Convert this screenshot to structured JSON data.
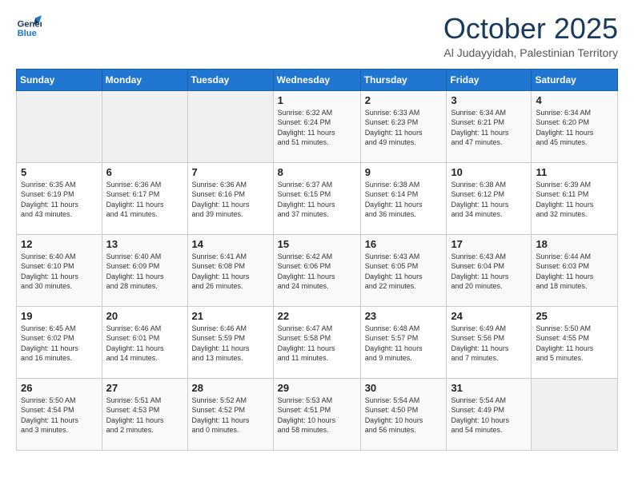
{
  "logo": {
    "line1": "General",
    "line2": "Blue"
  },
  "title": "October 2025",
  "location": "Al Judayyidah, Palestinian Territory",
  "headers": [
    "Sunday",
    "Monday",
    "Tuesday",
    "Wednesday",
    "Thursday",
    "Friday",
    "Saturday"
  ],
  "weeks": [
    [
      {
        "day": "",
        "info": ""
      },
      {
        "day": "",
        "info": ""
      },
      {
        "day": "",
        "info": ""
      },
      {
        "day": "1",
        "info": "Sunrise: 6:32 AM\nSunset: 6:24 PM\nDaylight: 11 hours\nand 51 minutes."
      },
      {
        "day": "2",
        "info": "Sunrise: 6:33 AM\nSunset: 6:23 PM\nDaylight: 11 hours\nand 49 minutes."
      },
      {
        "day": "3",
        "info": "Sunrise: 6:34 AM\nSunset: 6:21 PM\nDaylight: 11 hours\nand 47 minutes."
      },
      {
        "day": "4",
        "info": "Sunrise: 6:34 AM\nSunset: 6:20 PM\nDaylight: 11 hours\nand 45 minutes."
      }
    ],
    [
      {
        "day": "5",
        "info": "Sunrise: 6:35 AM\nSunset: 6:19 PM\nDaylight: 11 hours\nand 43 minutes."
      },
      {
        "day": "6",
        "info": "Sunrise: 6:36 AM\nSunset: 6:17 PM\nDaylight: 11 hours\nand 41 minutes."
      },
      {
        "day": "7",
        "info": "Sunrise: 6:36 AM\nSunset: 6:16 PM\nDaylight: 11 hours\nand 39 minutes."
      },
      {
        "day": "8",
        "info": "Sunrise: 6:37 AM\nSunset: 6:15 PM\nDaylight: 11 hours\nand 37 minutes."
      },
      {
        "day": "9",
        "info": "Sunrise: 6:38 AM\nSunset: 6:14 PM\nDaylight: 11 hours\nand 36 minutes."
      },
      {
        "day": "10",
        "info": "Sunrise: 6:38 AM\nSunset: 6:12 PM\nDaylight: 11 hours\nand 34 minutes."
      },
      {
        "day": "11",
        "info": "Sunrise: 6:39 AM\nSunset: 6:11 PM\nDaylight: 11 hours\nand 32 minutes."
      }
    ],
    [
      {
        "day": "12",
        "info": "Sunrise: 6:40 AM\nSunset: 6:10 PM\nDaylight: 11 hours\nand 30 minutes."
      },
      {
        "day": "13",
        "info": "Sunrise: 6:40 AM\nSunset: 6:09 PM\nDaylight: 11 hours\nand 28 minutes."
      },
      {
        "day": "14",
        "info": "Sunrise: 6:41 AM\nSunset: 6:08 PM\nDaylight: 11 hours\nand 26 minutes."
      },
      {
        "day": "15",
        "info": "Sunrise: 6:42 AM\nSunset: 6:06 PM\nDaylight: 11 hours\nand 24 minutes."
      },
      {
        "day": "16",
        "info": "Sunrise: 6:43 AM\nSunset: 6:05 PM\nDaylight: 11 hours\nand 22 minutes."
      },
      {
        "day": "17",
        "info": "Sunrise: 6:43 AM\nSunset: 6:04 PM\nDaylight: 11 hours\nand 20 minutes."
      },
      {
        "day": "18",
        "info": "Sunrise: 6:44 AM\nSunset: 6:03 PM\nDaylight: 11 hours\nand 18 minutes."
      }
    ],
    [
      {
        "day": "19",
        "info": "Sunrise: 6:45 AM\nSunset: 6:02 PM\nDaylight: 11 hours\nand 16 minutes."
      },
      {
        "day": "20",
        "info": "Sunrise: 6:46 AM\nSunset: 6:01 PM\nDaylight: 11 hours\nand 14 minutes."
      },
      {
        "day": "21",
        "info": "Sunrise: 6:46 AM\nSunset: 5:59 PM\nDaylight: 11 hours\nand 13 minutes."
      },
      {
        "day": "22",
        "info": "Sunrise: 6:47 AM\nSunset: 5:58 PM\nDaylight: 11 hours\nand 11 minutes."
      },
      {
        "day": "23",
        "info": "Sunrise: 6:48 AM\nSunset: 5:57 PM\nDaylight: 11 hours\nand 9 minutes."
      },
      {
        "day": "24",
        "info": "Sunrise: 6:49 AM\nSunset: 5:56 PM\nDaylight: 11 hours\nand 7 minutes."
      },
      {
        "day": "25",
        "info": "Sunrise: 5:50 AM\nSunset: 4:55 PM\nDaylight: 11 hours\nand 5 minutes."
      }
    ],
    [
      {
        "day": "26",
        "info": "Sunrise: 5:50 AM\nSunset: 4:54 PM\nDaylight: 11 hours\nand 3 minutes."
      },
      {
        "day": "27",
        "info": "Sunrise: 5:51 AM\nSunset: 4:53 PM\nDaylight: 11 hours\nand 2 minutes."
      },
      {
        "day": "28",
        "info": "Sunrise: 5:52 AM\nSunset: 4:52 PM\nDaylight: 11 hours\nand 0 minutes."
      },
      {
        "day": "29",
        "info": "Sunrise: 5:53 AM\nSunset: 4:51 PM\nDaylight: 10 hours\nand 58 minutes."
      },
      {
        "day": "30",
        "info": "Sunrise: 5:54 AM\nSunset: 4:50 PM\nDaylight: 10 hours\nand 56 minutes."
      },
      {
        "day": "31",
        "info": "Sunrise: 5:54 AM\nSunset: 4:49 PM\nDaylight: 10 hours\nand 54 minutes."
      },
      {
        "day": "",
        "info": ""
      }
    ]
  ]
}
